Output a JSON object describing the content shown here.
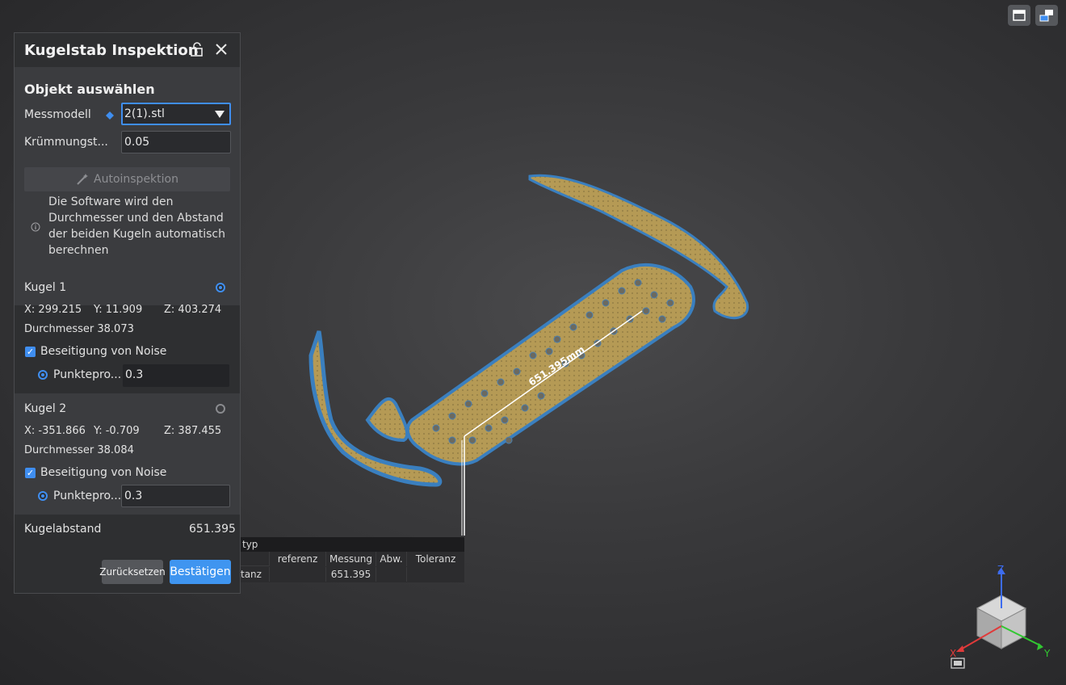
{
  "panel": {
    "title": "Kugelstab Inspektion",
    "section_title": "Objekt auswählen",
    "messmodell_label": "Messmodell",
    "messmodell_value": "2(1).stl",
    "kruemmung_label": "Krümmungst...",
    "kruemmung_value": "0.05",
    "auto_button": "Autoinspektion",
    "info_text": "Die Software wird den Durchmesser und den Abstand der beiden Kugeln automatisch berechnen"
  },
  "kugel1": {
    "title": "Kugel 1",
    "x": "X: 299.215",
    "y": "Y: 11.909",
    "z": "Z: 403.274",
    "diameter": "Durchmesser 38.073",
    "noise_label": "Beseitigung von Noise",
    "punkt_label": "Punktepro...",
    "punkt_value": "0.3"
  },
  "kugel2": {
    "title": "Kugel 2",
    "x": "X: -351.866",
    "y": "Y: -0.709",
    "z": "Z: 387.455",
    "diameter": "Durchmesser 38.084",
    "noise_label": "Beseitigung von Noise",
    "punkt_label": "Punktepro...",
    "punkt_value": "0.3"
  },
  "kugelabstand_label": "Kugelabstand",
  "kugelabstand_value": "651.395",
  "buttons": {
    "reset": "Zurücksetzen",
    "confirm": "Bestätigen"
  },
  "viewport": {
    "measurement_label": "651.395mm"
  },
  "result_table": {
    "group_header": "typ",
    "headers": [
      "referenz",
      "Messung",
      "Abw.",
      "Toleranz"
    ],
    "row": {
      "name": "tanz",
      "referenz": "",
      "messung": "651.395",
      "abw": "",
      "toleranz": ""
    }
  },
  "gizmo": {
    "x": "X",
    "y": "Y",
    "z": "Z"
  },
  "colors": {
    "accent": "#3f8ef0",
    "part_fill": "#b59a55",
    "part_edge": "#3a7fbf"
  }
}
